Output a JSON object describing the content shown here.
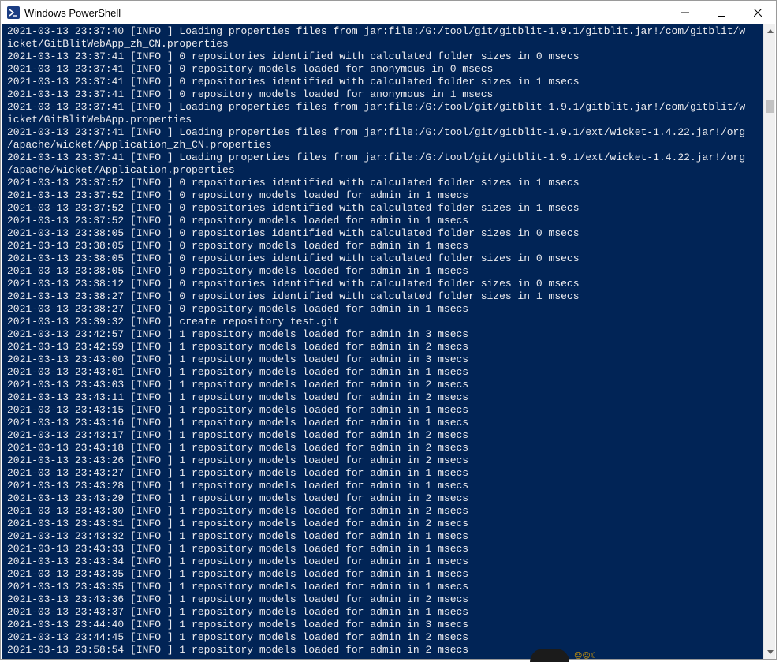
{
  "window": {
    "title": "Windows PowerShell",
    "icon": "powershell-icon",
    "controls": [
      "minimize-icon",
      "maximize-icon",
      "close-icon"
    ]
  },
  "colors": {
    "console_bg": "#012456",
    "console_fg": "#eeedf0"
  },
  "console": {
    "lines": [
      "2021-03-13 23:37:40 [INFO ] Loading properties files from jar:file:/G:/tool/git/gitblit-1.9.1/gitblit.jar!/com/gitblit/w",
      "icket/GitBlitWebApp_zh_CN.properties",
      "2021-03-13 23:37:41 [INFO ] 0 repositories identified with calculated folder sizes in 0 msecs",
      "2021-03-13 23:37:41 [INFO ] 0 repository models loaded for anonymous in 0 msecs",
      "2021-03-13 23:37:41 [INFO ] 0 repositories identified with calculated folder sizes in 1 msecs",
      "2021-03-13 23:37:41 [INFO ] 0 repository models loaded for anonymous in 1 msecs",
      "2021-03-13 23:37:41 [INFO ] Loading properties files from jar:file:/G:/tool/git/gitblit-1.9.1/gitblit.jar!/com/gitblit/w",
      "icket/GitBlitWebApp.properties",
      "2021-03-13 23:37:41 [INFO ] Loading properties files from jar:file:/G:/tool/git/gitblit-1.9.1/ext/wicket-1.4.22.jar!/org",
      "/apache/wicket/Application_zh_CN.properties",
      "2021-03-13 23:37:41 [INFO ] Loading properties files from jar:file:/G:/tool/git/gitblit-1.9.1/ext/wicket-1.4.22.jar!/org",
      "/apache/wicket/Application.properties",
      "2021-03-13 23:37:52 [INFO ] 0 repositories identified with calculated folder sizes in 1 msecs",
      "2021-03-13 23:37:52 [INFO ] 0 repository models loaded for admin in 1 msecs",
      "2021-03-13 23:37:52 [INFO ] 0 repositories identified with calculated folder sizes in 1 msecs",
      "2021-03-13 23:37:52 [INFO ] 0 repository models loaded for admin in 1 msecs",
      "2021-03-13 23:38:05 [INFO ] 0 repositories identified with calculated folder sizes in 0 msecs",
      "2021-03-13 23:38:05 [INFO ] 0 repository models loaded for admin in 1 msecs",
      "2021-03-13 23:38:05 [INFO ] 0 repositories identified with calculated folder sizes in 0 msecs",
      "2021-03-13 23:38:05 [INFO ] 0 repository models loaded for admin in 1 msecs",
      "2021-03-13 23:38:12 [INFO ] 0 repositories identified with calculated folder sizes in 0 msecs",
      "2021-03-13 23:38:27 [INFO ] 0 repositories identified with calculated folder sizes in 1 msecs",
      "2021-03-13 23:38:27 [INFO ] 0 repository models loaded for admin in 1 msecs",
      "2021-03-13 23:39:32 [INFO ] create repository test.git",
      "2021-03-13 23:42:57 [INFO ] 1 repository models loaded for admin in 3 msecs",
      "2021-03-13 23:42:59 [INFO ] 1 repository models loaded for admin in 2 msecs",
      "2021-03-13 23:43:00 [INFO ] 1 repository models loaded for admin in 3 msecs",
      "2021-03-13 23:43:01 [INFO ] 1 repository models loaded for admin in 1 msecs",
      "2021-03-13 23:43:03 [INFO ] 1 repository models loaded for admin in 2 msecs",
      "2021-03-13 23:43:11 [INFO ] 1 repository models loaded for admin in 2 msecs",
      "2021-03-13 23:43:15 [INFO ] 1 repository models loaded for admin in 1 msecs",
      "2021-03-13 23:43:16 [INFO ] 1 repository models loaded for admin in 1 msecs",
      "2021-03-13 23:43:17 [INFO ] 1 repository models loaded for admin in 2 msecs",
      "2021-03-13 23:43:18 [INFO ] 1 repository models loaded for admin in 2 msecs",
      "2021-03-13 23:43:26 [INFO ] 1 repository models loaded for admin in 2 msecs",
      "2021-03-13 23:43:27 [INFO ] 1 repository models loaded for admin in 1 msecs",
      "2021-03-13 23:43:28 [INFO ] 1 repository models loaded for admin in 1 msecs",
      "2021-03-13 23:43:29 [INFO ] 1 repository models loaded for admin in 2 msecs",
      "2021-03-13 23:43:30 [INFO ] 1 repository models loaded for admin in 2 msecs",
      "2021-03-13 23:43:31 [INFO ] 1 repository models loaded for admin in 2 msecs",
      "2021-03-13 23:43:32 [INFO ] 1 repository models loaded for admin in 1 msecs",
      "2021-03-13 23:43:33 [INFO ] 1 repository models loaded for admin in 1 msecs",
      "2021-03-13 23:43:34 [INFO ] 1 repository models loaded for admin in 1 msecs",
      "2021-03-13 23:43:35 [INFO ] 1 repository models loaded for admin in 1 msecs",
      "2021-03-13 23:43:35 [INFO ] 1 repository models loaded for admin in 1 msecs",
      "2021-03-13 23:43:36 [INFO ] 1 repository models loaded for admin in 2 msecs",
      "2021-03-13 23:43:37 [INFO ] 1 repository models loaded for admin in 1 msecs",
      "2021-03-13 23:44:40 [INFO ] 1 repository models loaded for admin in 3 msecs",
      "2021-03-13 23:44:45 [INFO ] 1 repository models loaded for admin in 2 msecs",
      "2021-03-13 23:58:54 [INFO ] 1 repository models loaded for admin in 2 msecs"
    ]
  }
}
